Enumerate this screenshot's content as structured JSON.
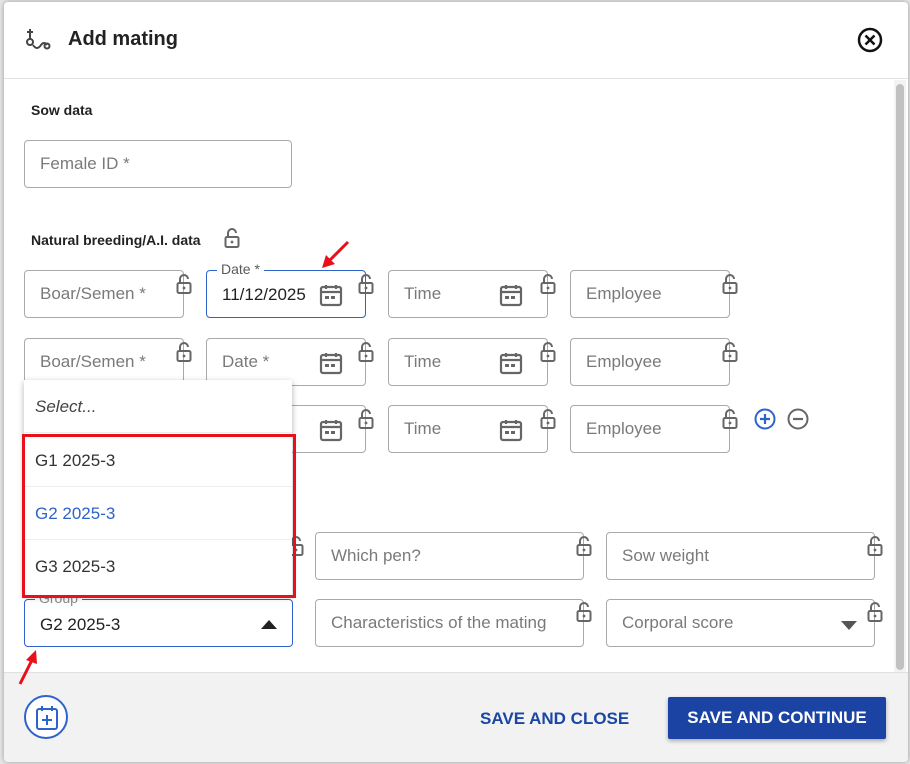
{
  "modal": {
    "title": "Add mating",
    "icons": {
      "title_icon": "mating-icon",
      "close_icon": "close-circle-icon"
    }
  },
  "sow_data": {
    "label": "Sow data",
    "female_id_placeholder": "Female ID *"
  },
  "breeding": {
    "label": "Natural breeding/A.I. data",
    "rows": [
      {
        "boar_placeholder": "Boar/Semen *",
        "date_label": "Date *",
        "date_value": "11/12/2025",
        "time_placeholder": "Time",
        "employee_placeholder": "Employee"
      },
      {
        "boar_placeholder": "Boar/Semen *",
        "date_placeholder": "Date *",
        "time_placeholder": "Time",
        "employee_placeholder": "Employee"
      },
      {
        "time_placeholder": "Time",
        "employee_placeholder": "Employee"
      }
    ]
  },
  "other": {
    "which_pen_placeholder": "Which pen?",
    "sow_weight_placeholder": "Sow weight",
    "group_label": "Group",
    "group_value": "G2 2025-3",
    "characteristics_placeholder": "Characteristics of the mating",
    "corporal_score_placeholder": "Corporal score"
  },
  "group_dropdown": {
    "options": [
      "Select...",
      "G1 2025-3",
      "G2 2025-3",
      "G3 2025-3"
    ],
    "selected": "G2 2025-3"
  },
  "footer": {
    "save_close_label": "SAVE AND CLOSE",
    "save_continue_label": "SAVE AND CONTINUE"
  },
  "colors": {
    "accent": "#2e63c9",
    "primary_button": "#1b43a3",
    "highlight": "#e8101a"
  }
}
